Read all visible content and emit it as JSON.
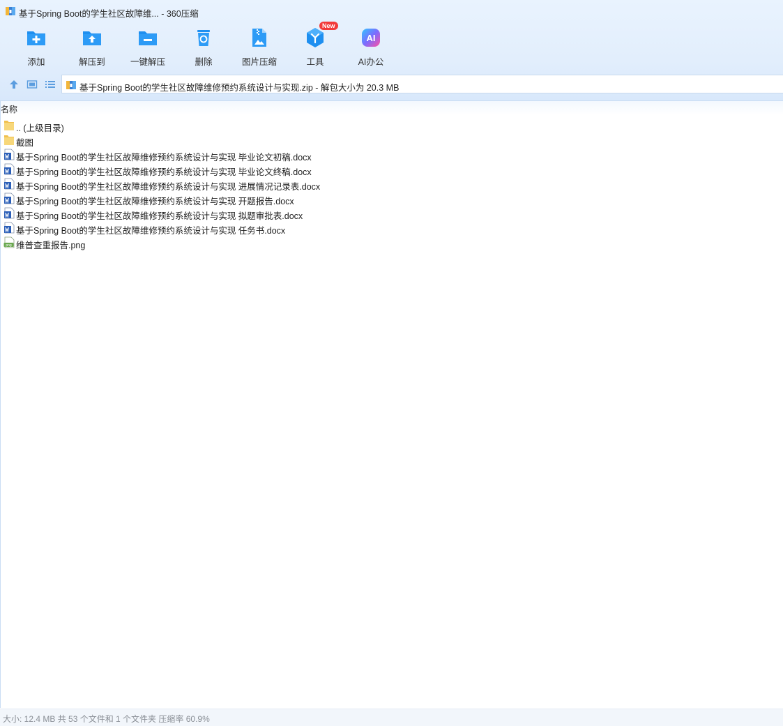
{
  "window": {
    "title": "基于Spring Boot的学生社区故障维... - 360压缩"
  },
  "toolbar": {
    "items": [
      {
        "label": "添加",
        "icon": "add-folder-icon"
      },
      {
        "label": "解压到",
        "icon": "extract-to-icon"
      },
      {
        "label": "一键解压",
        "icon": "one-click-extract-icon"
      },
      {
        "label": "删除",
        "icon": "recycle-bin-icon"
      },
      {
        "label": "图片压缩",
        "icon": "image-compress-icon"
      },
      {
        "label": "工具",
        "icon": "tools-icon",
        "badge": "New"
      },
      {
        "label": "AI办公",
        "icon": "ai-office-icon",
        "icon_text": "AI"
      }
    ]
  },
  "address": {
    "text": "基于Spring Boot的学生社区故障维修预约系统设计与实现.zip - 解包大小为 20.3 MB"
  },
  "filelist": {
    "column_name": "名称",
    "rows": [
      {
        "name": ".. (上级目录)",
        "type": "folder"
      },
      {
        "name": "截图",
        "type": "folder"
      },
      {
        "name": "基于Spring Boot的学生社区故障维修预约系统设计与实现 毕业论文初稿.docx",
        "type": "docx"
      },
      {
        "name": "基于Spring Boot的学生社区故障维修预约系统设计与实现 毕业论文终稿.docx",
        "type": "docx"
      },
      {
        "name": "基于Spring Boot的学生社区故障维修预约系统设计与实现 进展情况记录表.docx",
        "type": "docx"
      },
      {
        "name": "基于Spring Boot的学生社区故障维修预约系统设计与实现 开题报告.docx",
        "type": "docx"
      },
      {
        "name": "基于Spring Boot的学生社区故障维修预约系统设计与实现 拟题审批表.docx",
        "type": "docx"
      },
      {
        "name": "基于Spring Boot的学生社区故障维修预约系统设计与实现 任务书.docx",
        "type": "docx"
      },
      {
        "name": "维普查重报告.png",
        "type": "png",
        "icon_text": "png"
      }
    ]
  },
  "status": {
    "text": "大小: 12.4 MB 共 53 个文件和 1 个文件夹 压缩率 60.9%"
  },
  "colors": {
    "accent": "#1e8ff0",
    "badge": "#f23a3a",
    "word": "#2b5fb8",
    "folder": "#f7cf63"
  }
}
